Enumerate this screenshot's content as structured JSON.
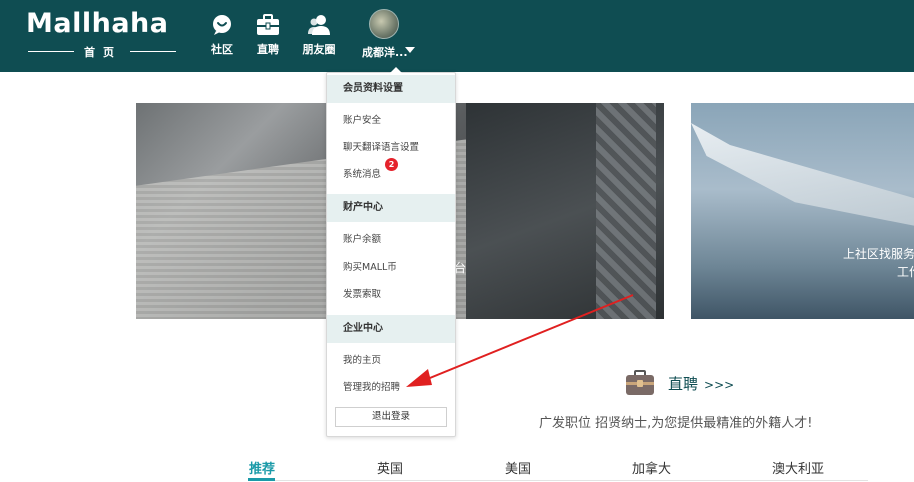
{
  "header": {
    "logo_text": "Mallhaha",
    "logo_sub": "首页",
    "nav": [
      {
        "label": "社区",
        "icon": "chat-bubble-icon"
      },
      {
        "label": "直聘",
        "icon": "briefcase-icon"
      },
      {
        "label": "朋友圈",
        "icon": "friends-icon"
      }
    ],
    "user_name": "成都洋..."
  },
  "dropdown": {
    "sections": [
      {
        "title": "会员资料设置",
        "items": [
          "账户安全",
          "聊天翻译语言设置",
          "系统消息"
        ]
      },
      {
        "title": "财产中心",
        "items": [
          "账户余额",
          "购买MALL币",
          "发票索取"
        ]
      },
      {
        "title": "企业中心",
        "items": [
          "我的主页",
          "管理我的招聘"
        ]
      }
    ],
    "message_badge": "2",
    "logout_label": "退出登录"
  },
  "banners": {
    "left_text": "台",
    "right_text_1": "上社区找服务，",
    "right_text_2": "工作"
  },
  "recruit": {
    "title": "直聘",
    "chevrons": ">>>",
    "description": "广发职位 招贤纳士,为您提供最精准的外籍人才!"
  },
  "tabs": [
    "推荐",
    "英国",
    "美国",
    "加拿大",
    "澳大利亚"
  ],
  "colors": {
    "header_bg": "#0f4d52",
    "accent": "#1a9aa8",
    "badge": "#e5232c",
    "annotation_arrow": "#e02020"
  }
}
